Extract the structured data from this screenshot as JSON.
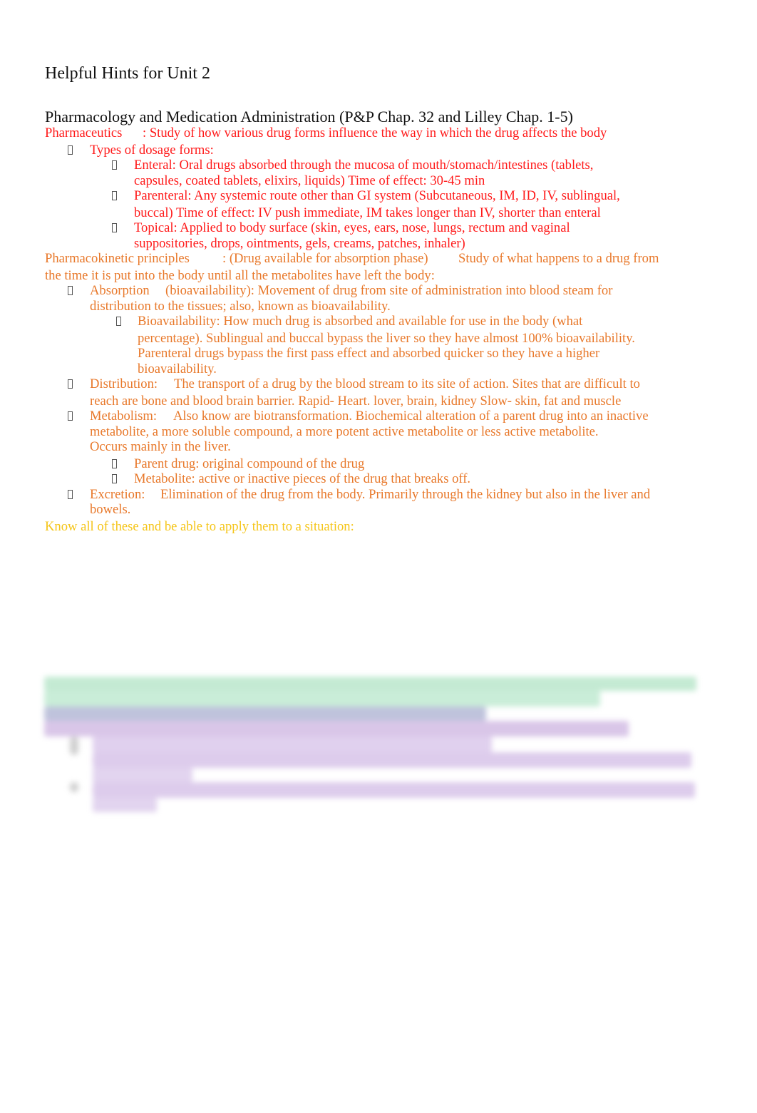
{
  "document": {
    "title": "Helpful Hints for Unit 2",
    "section_heading": "Pharmacology and Medication Administration (P&P Chap. 32 and Lilley Chap. 1-5)",
    "pharmaceutics": {
      "term": "Pharmaceutics",
      "definition": ": Study of how various drug forms influence the way in which the drug affects the body",
      "types_label": "Types of dosage forms:",
      "forms": [
        {
          "line1": "Enteral: Oral drugs absorbed through the mucosa of mouth/stomach/intestines (tablets,",
          "line2": "capsules, coated tablets, elixirs, liquids) Time of effect: 30-45 min"
        },
        {
          "line1": "Parenteral: Any systemic route other than GI system (Subcutaneous, IM, ID, IV, sublingual,",
          "line2": "buccal) Time of effect: IV push immediate, IM takes longer than IV, shorter than enteral"
        },
        {
          "line1": "Topical: Applied to body surface (skin, eyes, ears, nose, lungs, rectum and vaginal",
          "line2": "suppositories, drops, ointments, gels, creams, patches, inhaler)"
        }
      ]
    },
    "pharmacokinetics": {
      "term": "Pharmacokinetic principles",
      "note": ": (Drug available for absorption phase)",
      "definition_line1": "Study of what happens to a drug from",
      "definition_line2": "the time it is put into the body until all the metabolites have left the body:",
      "absorption": {
        "term": "Absorption",
        "line1": "(bioavailability): Movement of drug from site of administration into blood steam for",
        "line2": "distribution to the tissues; also, known as bioavailability.",
        "sub": [
          "Bioavailability: How much drug is absorbed and available for use in the body (what",
          "percentage). Sublingual and buccal bypass the liver so they have almost 100% bioavailability.",
          "Parenteral drugs bypass the first pass effect and absorbed quicker so they have a higher",
          "bioavailability."
        ]
      },
      "distribution": {
        "term": "Distribution:",
        "line1": "The transport of a drug by the blood stream to its site of action. Sites that are difficult to",
        "line2": "reach are bone and blood brain barrier. Rapid- Heart. lover, brain, kidney Slow- skin, fat and muscle"
      },
      "metabolism": {
        "term": "Metabolism:",
        "line1": "Also know are biotransformation. Biochemical alteration of a parent drug into an inactive",
        "line2": "metabolite, a more soluble compound, a more potent active metabolite or less active metabolite.",
        "line3": "Occurs mainly in the liver.",
        "sub": [
          "Parent drug: original compound of the drug",
          "Metabolite: active or inactive pieces of the drug that breaks off."
        ]
      },
      "excretion": {
        "term": "Excretion:",
        "line1": "Elimination of the drug from the body. Primarily through the kidney but also in the liver and",
        "line2": "bowels."
      }
    },
    "closing_note": "Know all of these and be able to apply them to a situation:",
    "blurred_section": {
      "visible": true
    }
  },
  "colors": {
    "pharmaceutics": "#ff1a1a",
    "pharmacokinetics": "#e8782a",
    "closing": "#f5c518",
    "blur_green": "#bfe8d0",
    "blur_blue": "#b8bcd6",
    "blur_purple": "#d8c4e6"
  }
}
